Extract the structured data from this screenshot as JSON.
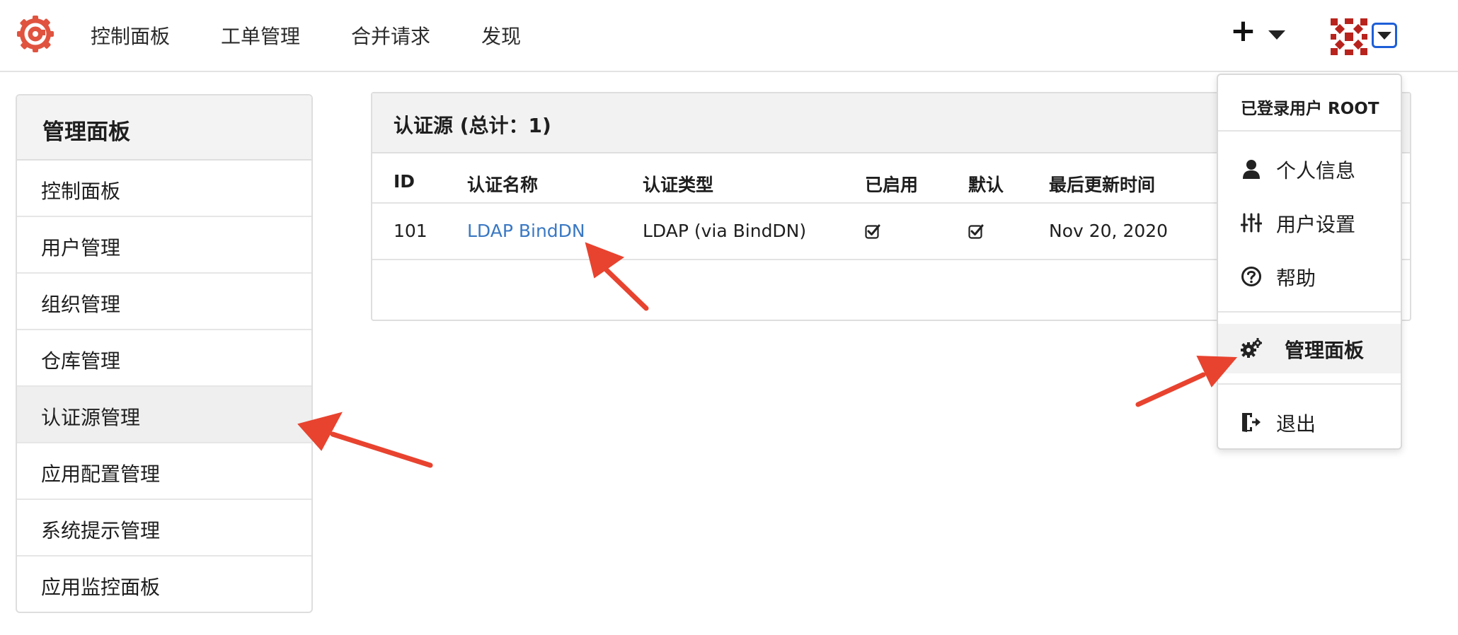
{
  "nav": {
    "items": [
      "控制面板",
      "工单管理",
      "合并请求",
      "发现"
    ],
    "create_glyph": "+"
  },
  "sidebar": {
    "title": "管理面板",
    "items": [
      "控制面板",
      "用户管理",
      "组织管理",
      "仓库管理",
      "认证源管理",
      "应用配置管理",
      "系统提示管理",
      "应用监控面板"
    ],
    "active_index": 4
  },
  "panel": {
    "title": "认证源 (总计：1)",
    "columns": [
      "ID",
      "认证名称",
      "认证类型",
      "已启用",
      "默认",
      "最后更新时间"
    ],
    "rows": [
      {
        "id": "101",
        "name": "LDAP BindDN",
        "type": "LDAP (via BindDN)",
        "enabled": true,
        "default": true,
        "updated": "Nov 20, 2020"
      }
    ]
  },
  "dropdown": {
    "header": "已登录用户 ROOT",
    "items": [
      {
        "label": "个人信息",
        "icon": "user-icon"
      },
      {
        "label": "用户设置",
        "icon": "sliders-icon"
      },
      {
        "label": "帮助",
        "icon": "question-circle-icon"
      },
      {
        "label": "管理面板",
        "icon": "gears-icon",
        "active": true
      },
      {
        "label": "退出",
        "icon": "sign-out-icon"
      }
    ]
  },
  "colors": {
    "logo": "#e0533f",
    "link": "#3a78c3",
    "arrow": "#e8432f",
    "focus": "#1e5fd8"
  }
}
